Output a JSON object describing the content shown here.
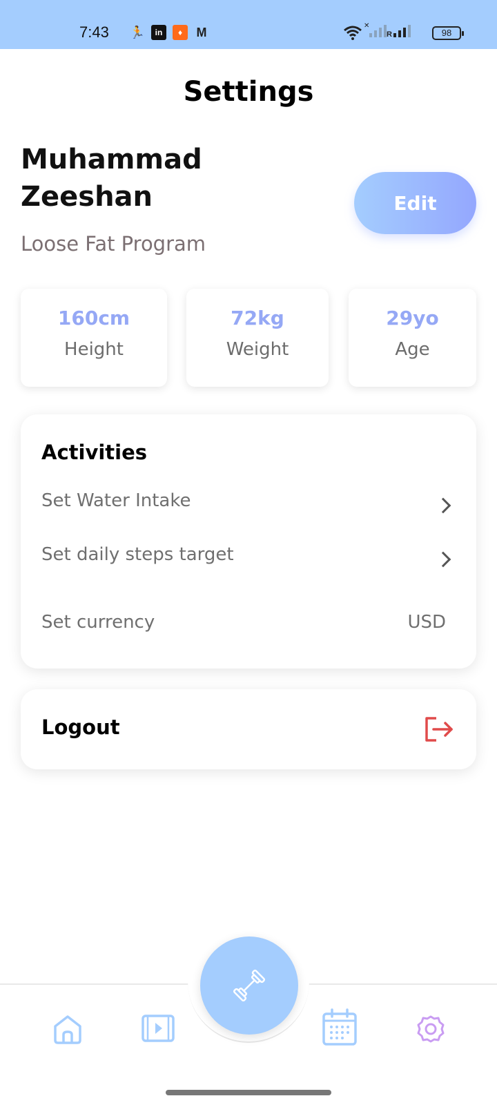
{
  "status_bar": {
    "time": "7:43",
    "battery": "98",
    "network_label": "R"
  },
  "header": {
    "title": "Settings"
  },
  "profile": {
    "name": "Muhammad\nZeeshan",
    "program": "Loose Fat Program",
    "edit_label": "Edit"
  },
  "stats": [
    {
      "value": "160cm",
      "label": "Height"
    },
    {
      "value": "72kg",
      "label": "Weight"
    },
    {
      "value": "29yo",
      "label": "Age"
    }
  ],
  "activities": {
    "title": "Activities",
    "items": [
      {
        "label": "Set Water Intake"
      },
      {
        "label": "Set daily steps target"
      },
      {
        "label": "Set currency",
        "value": "USD"
      }
    ]
  },
  "logout": {
    "label": "Logout"
  },
  "bottom_nav": {
    "items": [
      {
        "icon": "home-icon"
      },
      {
        "icon": "video-icon"
      },
      {
        "icon": "dumbbell-icon"
      },
      {
        "icon": "calendar-icon"
      },
      {
        "icon": "settings-icon"
      }
    ]
  },
  "colors": {
    "accent_blue": "#a4cdfe",
    "accent_purple": "#94a7fe",
    "stat_value": "#95a8f5",
    "logout_red": "#e04b4b",
    "settings_icon": "#c99cf2"
  }
}
